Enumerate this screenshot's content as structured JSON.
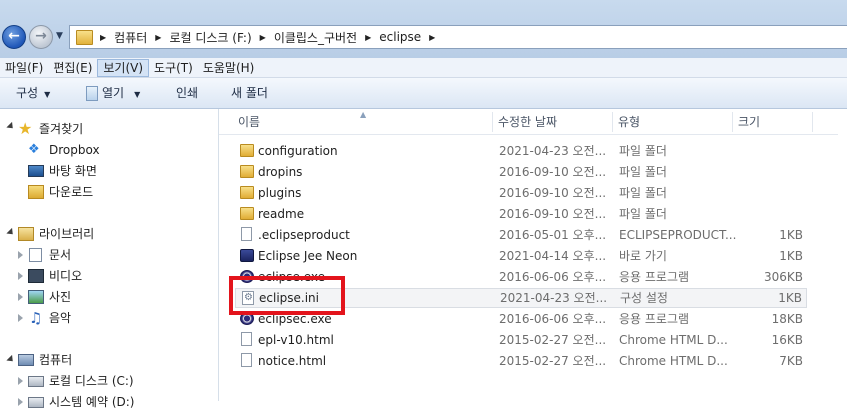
{
  "address_bar": {
    "crumbs": [
      "컴퓨터",
      "로컬 디스크 (F:)",
      "이클립스_구버전",
      "eclipse"
    ]
  },
  "menu": {
    "items": [
      {
        "label": "파일(F)"
      },
      {
        "label": "편집(E)"
      },
      {
        "label": "보기(V)",
        "active": true
      },
      {
        "label": "도구(T)"
      },
      {
        "label": "도움말(H)"
      }
    ]
  },
  "toolbar": {
    "organize_label": "구성",
    "open_label": "열기",
    "print_label": "인쇄",
    "new_folder_label": "새 폴더"
  },
  "nav": {
    "favorites": {
      "label": "즐겨찾기",
      "items": [
        {
          "label": "Dropbox",
          "icon": "dropbox-icon"
        },
        {
          "label": "바탕 화면",
          "icon": "desktop-icon"
        },
        {
          "label": "다운로드",
          "icon": "downloads-folder-icon"
        }
      ]
    },
    "libraries": {
      "label": "라이브러리",
      "items": [
        {
          "label": "문서",
          "icon": "documents-icon"
        },
        {
          "label": "비디오",
          "icon": "video-icon"
        },
        {
          "label": "사진",
          "icon": "pictures-icon"
        },
        {
          "label": "음악",
          "icon": "music-icon"
        }
      ]
    },
    "computer": {
      "label": "컴퓨터",
      "items": [
        {
          "label": "로컬 디스크 (C:)",
          "icon": "drive-icon"
        },
        {
          "label": "시스템 예약 (D:)",
          "icon": "drive-icon"
        }
      ]
    }
  },
  "columns": {
    "name": "이름",
    "date": "수정한 날짜",
    "type": "유형",
    "size": "크기"
  },
  "files": [
    {
      "name": "configuration",
      "date": "2021-04-23 오전...",
      "type": "파일 폴더",
      "size": "",
      "icon": "folder-icon"
    },
    {
      "name": "dropins",
      "date": "2016-09-10 오전...",
      "type": "파일 폴더",
      "size": "",
      "icon": "folder-icon"
    },
    {
      "name": "plugins",
      "date": "2016-09-10 오전...",
      "type": "파일 폴더",
      "size": "",
      "icon": "folder-icon"
    },
    {
      "name": "readme",
      "date": "2016-09-10 오전...",
      "type": "파일 폴더",
      "size": "",
      "icon": "folder-icon"
    },
    {
      "name": ".eclipseproduct",
      "date": "2016-05-01 오후...",
      "type": "ECLIPSEPRODUCT...",
      "size": "1KB",
      "icon": "document-icon"
    },
    {
      "name": "Eclipse Jee Neon",
      "date": "2021-04-14 오후...",
      "type": "바로 가기",
      "size": "1KB",
      "icon": "shortcut-icon"
    },
    {
      "name": "eclipse.exe",
      "date": "2016-06-06 오후...",
      "type": "응용 프로그램",
      "size": "306KB",
      "icon": "eclipse-exe-icon"
    },
    {
      "name": "eclipse.ini",
      "date": "2021-04-23 오전...",
      "type": "구성 설정",
      "size": "1KB",
      "icon": "config-settings-icon",
      "hovered": true
    },
    {
      "name": "eclipsec.exe",
      "date": "2016-06-06 오후...",
      "type": "응용 프로그램",
      "size": "18KB",
      "icon": "eclipse-exe-icon"
    },
    {
      "name": "epl-v10.html",
      "date": "2015-02-27 오전...",
      "type": "Chrome HTML D...",
      "size": "16KB",
      "icon": "html-document-icon"
    },
    {
      "name": "notice.html",
      "date": "2015-02-27 오전...",
      "type": "Chrome HTML D...",
      "size": "7KB",
      "icon": "html-document-icon"
    }
  ],
  "colors": {
    "highlight_box": "#e3141c",
    "address_bar_bg": "#c8daee",
    "menu_active_bg": "#d4e3f5"
  }
}
